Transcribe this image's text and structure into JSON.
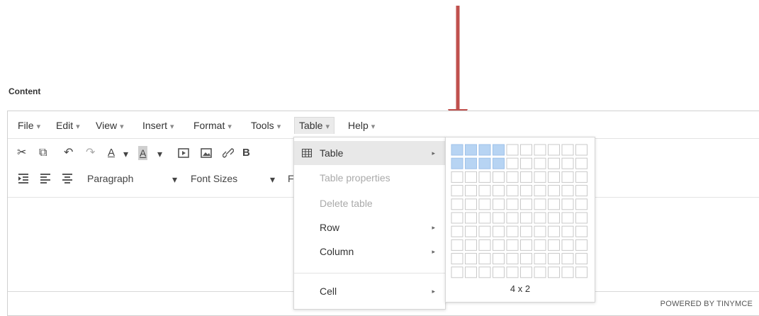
{
  "content_label": "Content",
  "menubar": [
    {
      "label": "File",
      "caret": "▾"
    },
    {
      "label": "Edit",
      "caret": "▾"
    },
    {
      "label": "View",
      "caret": "▾"
    },
    {
      "label": "Insert",
      "caret": "▾"
    },
    {
      "label": "Format",
      "caret": "▾"
    },
    {
      "label": "Tools",
      "caret": "▾"
    },
    {
      "label": "Table",
      "caret": "▾"
    },
    {
      "label": "Help",
      "caret": "▾"
    }
  ],
  "toolbar1": {
    "cut_icon": "✂",
    "copy_icon": "⧉",
    "undo_icon": "↶",
    "redo_icon": "↷",
    "text_color_icon": "A",
    "bg_color_icon": "A",
    "caret": "▾",
    "bold": "B"
  },
  "toolbar2": {
    "paragraph": "Paragraph",
    "font_sizes": "Font Sizes",
    "caret": "▾",
    "partial": "F"
  },
  "table_menu": {
    "items": [
      {
        "label": "Table",
        "arrow": "▸"
      },
      {
        "label": "Table properties"
      },
      {
        "label": "Delete table"
      },
      {
        "label": "Row",
        "arrow": "▸"
      },
      {
        "label": "Column",
        "arrow": "▸"
      },
      {
        "label": "Cell",
        "arrow": "▸"
      }
    ]
  },
  "grid_picker": {
    "columns": 10,
    "rows": 10,
    "selected_cols": 4,
    "selected_rows": 2,
    "label": "4 x 2",
    "selected_color": "#b7d4f3",
    "cell_border": "#c9c9c9"
  },
  "statusbar": {
    "powered_by": "POWERED BY TINYMCE"
  },
  "colors": {
    "arrow": "#c0504d",
    "menu_highlight": "#e8e8e8"
  }
}
